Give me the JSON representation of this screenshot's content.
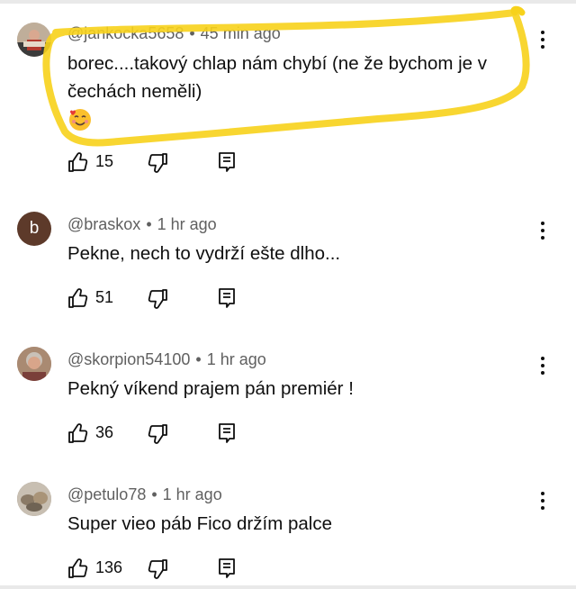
{
  "comments": [
    {
      "handle": "@jankocka5658",
      "time": "45 min ago",
      "text_line1": "borec....takový chlap nám chybí (ne že bychom je v",
      "text_line2": "čechách neměli)",
      "emoji": "smiling face with hearts",
      "likes": "15"
    },
    {
      "handle": "@braskox",
      "time": "1 hr ago",
      "text": "Pekne, nech to vydrží ešte dlho...",
      "avatar_letter": "b",
      "likes": "51"
    },
    {
      "handle": "@skorpion54100",
      "time": "1 hr ago",
      "text": "Pekný víkend prajem pán premiér !",
      "likes": "36"
    },
    {
      "handle": "@petulo78",
      "time": "1 hr ago",
      "text": "Super vieo páb Fico držím palce",
      "likes": "136"
    }
  ],
  "meta_separator": "•",
  "colors": {
    "highlight": "#f7d21b",
    "meta_text": "#606060",
    "text": "#0f0f0f"
  },
  "icons": [
    "like-icon",
    "dislike-icon",
    "reply-icon",
    "more-vert-icon"
  ]
}
